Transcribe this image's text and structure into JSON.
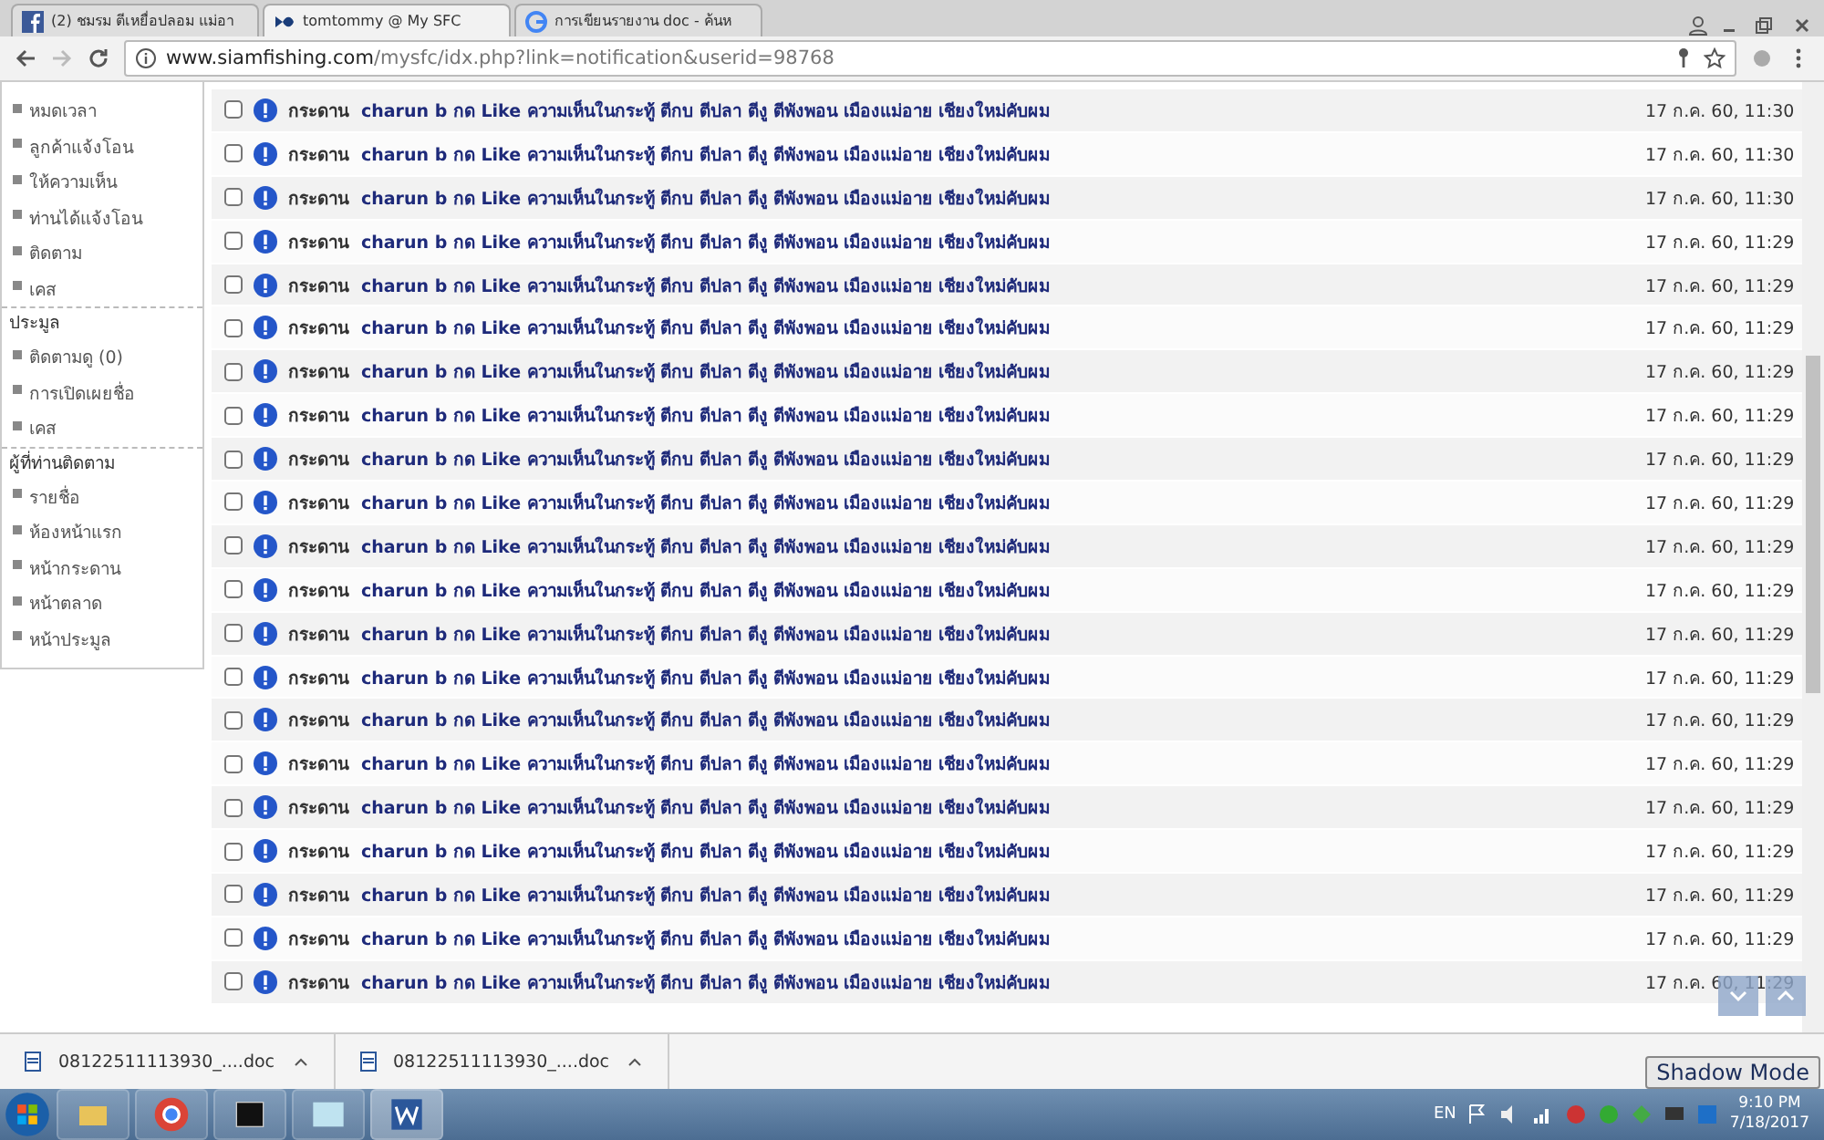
{
  "browser": {
    "tabs": [
      {
        "title": "(2) ชมรม ตีเหยื่อปลอม แม่อา",
        "selected": false,
        "kind": "facebook"
      },
      {
        "title": "tomtommy @ My SFC",
        "selected": true,
        "kind": "site"
      },
      {
        "title": "การเขียนรายงาน doc - ค้นห",
        "selected": false,
        "kind": "google"
      }
    ],
    "url_host": "www.siamfishing.com",
    "url_path": "/mysfc/idx.php?link=notification&userid=98768"
  },
  "sidebar": {
    "groups": [
      {
        "items": [
          "หมดเวลา",
          "ลูกค้าแจ้งโอน",
          "ให้ความเห็น",
          "ท่านได้แจ้งโอน",
          "ติดตาม",
          "เคส"
        ]
      },
      {
        "heading": "ประมูล",
        "items": [
          "ติดตามดู (0)",
          "การเปิดเผยชื่อ",
          "เคส"
        ]
      },
      {
        "heading": "ผู้ที่ท่านติดตาม",
        "items": [
          "รายชื่อ",
          "ห้องหน้าแรก",
          "หน้ากระดาน",
          "หน้าตลาด",
          "หน้าประมูล"
        ]
      }
    ]
  },
  "notifications": [
    {
      "checked": false,
      "source": "กระดาน",
      "message": "charun b กด Like ความเห็นในกระทู้ ตีกบ ตีปลา ตีงู ตีพังพอน เมืองแม่อาย เชียงใหม่คับผม",
      "time": "17 ก.ค. 60, 11:30"
    },
    {
      "checked": false,
      "source": "กระดาน",
      "message": "charun b กด Like ความเห็นในกระทู้ ตีกบ ตีปลา ตีงู ตีพังพอน เมืองแม่อาย เชียงใหม่คับผม",
      "time": "17 ก.ค. 60, 11:30"
    },
    {
      "checked": false,
      "source": "กระดาน",
      "message": "charun b กด Like ความเห็นในกระทู้ ตีกบ ตีปลา ตีงู ตีพังพอน เมืองแม่อาย เชียงใหม่คับผม",
      "time": "17 ก.ค. 60, 11:30"
    },
    {
      "checked": false,
      "source": "กระดาน",
      "message": "charun b กด Like ความเห็นในกระทู้ ตีกบ ตีปลา ตีงู ตีพังพอน เมืองแม่อาย เชียงใหม่คับผม",
      "time": "17 ก.ค. 60, 11:29"
    },
    {
      "checked": false,
      "source": "กระดาน",
      "message": "charun b กด Like ความเห็นในกระทู้ ตีกบ ตีปลา ตีงู ตีพังพอน เมืองแม่อาย เชียงใหม่คับผม",
      "time": "17 ก.ค. 60, 11:29"
    },
    {
      "checked": false,
      "source": "กระดาน",
      "message": "charun b กด Like ความเห็นในกระทู้ ตีกบ ตีปลา ตีงู ตีพังพอน เมืองแม่อาย เชียงใหม่คับผม",
      "time": "17 ก.ค. 60, 11:29"
    },
    {
      "checked": false,
      "source": "กระดาน",
      "message": "charun b กด Like ความเห็นในกระทู้ ตีกบ ตีปลา ตีงู ตีพังพอน เมืองแม่อาย เชียงใหม่คับผม",
      "time": "17 ก.ค. 60, 11:29"
    },
    {
      "checked": false,
      "source": "กระดาน",
      "message": "charun b กด Like ความเห็นในกระทู้ ตีกบ ตีปลา ตีงู ตีพังพอน เมืองแม่อาย เชียงใหม่คับผม",
      "time": "17 ก.ค. 60, 11:29"
    },
    {
      "checked": false,
      "source": "กระดาน",
      "message": "charun b กด Like ความเห็นในกระทู้ ตีกบ ตีปลา ตีงู ตีพังพอน เมืองแม่อาย เชียงใหม่คับผม",
      "time": "17 ก.ค. 60, 11:29"
    },
    {
      "checked": false,
      "source": "กระดาน",
      "message": "charun b กด Like ความเห็นในกระทู้ ตีกบ ตีปลา ตีงู ตีพังพอน เมืองแม่อาย เชียงใหม่คับผม",
      "time": "17 ก.ค. 60, 11:29"
    },
    {
      "checked": false,
      "source": "กระดาน",
      "message": "charun b กด Like ความเห็นในกระทู้ ตีกบ ตีปลา ตีงู ตีพังพอน เมืองแม่อาย เชียงใหม่คับผม",
      "time": "17 ก.ค. 60, 11:29"
    },
    {
      "checked": false,
      "source": "กระดาน",
      "message": "charun b กด Like ความเห็นในกระทู้ ตีกบ ตีปลา ตีงู ตีพังพอน เมืองแม่อาย เชียงใหม่คับผม",
      "time": "17 ก.ค. 60, 11:29"
    },
    {
      "checked": false,
      "source": "กระดาน",
      "message": "charun b กด Like ความเห็นในกระทู้ ตีกบ ตีปลา ตีงู ตีพังพอน เมืองแม่อาย เชียงใหม่คับผม",
      "time": "17 ก.ค. 60, 11:29"
    },
    {
      "checked": false,
      "source": "กระดาน",
      "message": "charun b กด Like ความเห็นในกระทู้ ตีกบ ตีปลา ตีงู ตีพังพอน เมืองแม่อาย เชียงใหม่คับผม",
      "time": "17 ก.ค. 60, 11:29"
    },
    {
      "checked": false,
      "source": "กระดาน",
      "message": "charun b กด Like ความเห็นในกระทู้ ตีกบ ตีปลา ตีงู ตีพังพอน เมืองแม่อาย เชียงใหม่คับผม",
      "time": "17 ก.ค. 60, 11:29"
    },
    {
      "checked": false,
      "source": "กระดาน",
      "message": "charun b กด Like ความเห็นในกระทู้ ตีกบ ตีปลา ตีงู ตีพังพอน เมืองแม่อาย เชียงใหม่คับผม",
      "time": "17 ก.ค. 60, 11:29"
    },
    {
      "checked": false,
      "source": "กระดาน",
      "message": "charun b กด Like ความเห็นในกระทู้ ตีกบ ตีปลา ตีงู ตีพังพอน เมืองแม่อาย เชียงใหม่คับผม",
      "time": "17 ก.ค. 60, 11:29"
    },
    {
      "checked": false,
      "source": "กระดาน",
      "message": "charun b กด Like ความเห็นในกระทู้ ตีกบ ตีปลา ตีงู ตีพังพอน เมืองแม่อาย เชียงใหม่คับผม",
      "time": "17 ก.ค. 60, 11:29"
    },
    {
      "checked": false,
      "source": "กระดาน",
      "message": "charun b กด Like ความเห็นในกระทู้ ตีกบ ตีปลา ตีงู ตีพังพอน เมืองแม่อาย เชียงใหม่คับผม",
      "time": "17 ก.ค. 60, 11:29"
    },
    {
      "checked": false,
      "source": "กระดาน",
      "message": "charun b กด Like ความเห็นในกระทู้ ตีกบ ตีปลา ตีงู ตีพังพอน เมืองแม่อาย เชียงใหม่คับผม",
      "time": "17 ก.ค. 60, 11:29"
    },
    {
      "checked": false,
      "source": "กระดาน",
      "message": "charun b กด Like ความเห็นในกระทู้ ตีกบ ตีปลา ตีงู ตีพังพอน เมืองแม่อาย เชียงใหม่คับผม",
      "time": "17 ก.ค. 60, 11:29"
    }
  ],
  "downloads": [
    "08122511113930_....doc",
    "08122511113930_....doc"
  ],
  "overlay_label": "Shadow Mode",
  "taskbar": {
    "language": "EN",
    "time": "9:10 PM",
    "date": "7/18/2017"
  }
}
